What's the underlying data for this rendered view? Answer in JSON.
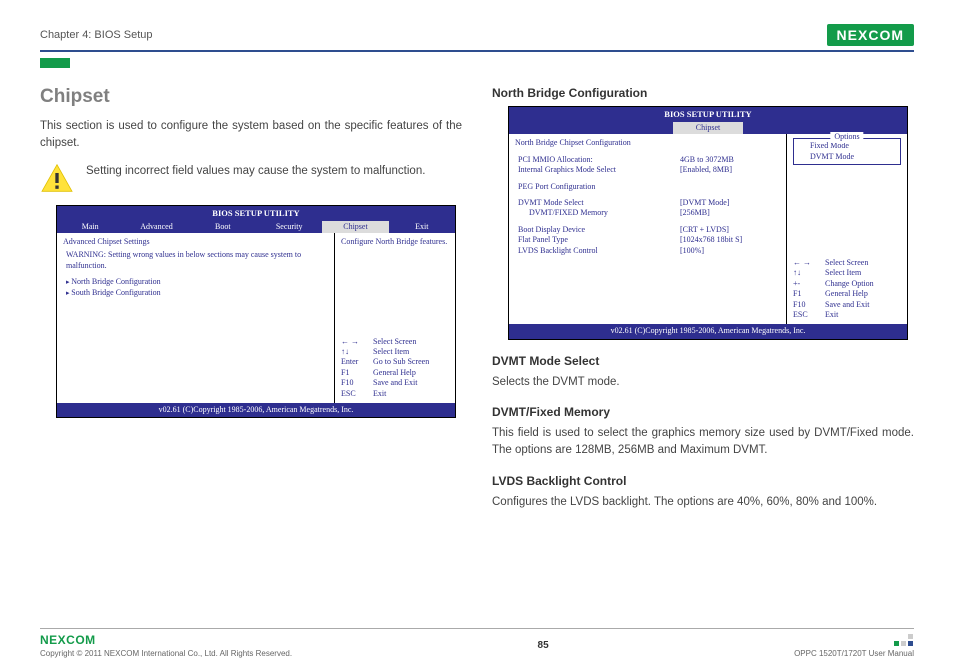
{
  "header": {
    "chapter": "Chapter 4: BIOS Setup",
    "brand": "NEXCOM"
  },
  "left": {
    "title": "Chipset",
    "intro": "This section is used to configure the system based on the specific features of the chipset.",
    "warning": "Setting incorrect field values may cause the system to malfunction.",
    "bios": {
      "title": "BIOS SETUP UTILITY",
      "tabs": {
        "main": "Main",
        "advanced": "Advanced",
        "boot": "Boot",
        "security": "Security",
        "chipset": "Chipset",
        "exit": "Exit"
      },
      "heading": "Advanced Chipset Settings",
      "warn": "WARNING: Setting wrong values in below sections may cause system to malfunction.",
      "items": {
        "nb": "North Bridge Configuration",
        "sb": "South Bridge Configuration"
      },
      "hint": "Configure North Bridge features.",
      "keys": {
        "k1": "← →",
        "v1": "Select Screen",
        "k2": "↑↓",
        "v2": "Select Item",
        "k3": "Enter",
        "v3": "Go to Sub Screen",
        "k4": "F1",
        "v4": "General Help",
        "k5": "F10",
        "v5": "Save and Exit",
        "k6": "ESC",
        "v6": "Exit"
      },
      "foot": "v02.61 (C)Copyright 1985-2006, American Megatrends, Inc."
    }
  },
  "right": {
    "title": "North Bridge Configuration",
    "bios": {
      "title": "BIOS SETUP UTILITY",
      "tab": "Chipset",
      "heading": "North Bridge Chipset Configuration",
      "rows": {
        "r1k": "PCI MMIO Allocation:",
        "r1v": "4GB to 3072MB",
        "r2k": "Internal Graphics Mode Select",
        "r2v": "[Enabled, 8MB]",
        "r3k": "PEG Port Configuration",
        "r4k": "DVMT Mode Select",
        "r4v": "[DVMT Mode]",
        "r5k": "DVMT/FIXED Memory",
        "r5v": "[256MB]",
        "r6k": "Boot Display Device",
        "r6v": "[CRT + LVDS]",
        "r7k": "Flat Panel Type",
        "r7v": "[1024x768 18bit S]",
        "r8k": "LVDS Backlight Control",
        "r8v": "[100%]"
      },
      "options_label": "Options",
      "options": {
        "o1": "Fixed Mode",
        "o2": "DVMT Mode"
      },
      "keys": {
        "k1": "← →",
        "v1": "Select Screen",
        "k2": "↑↓",
        "v2": "Select Item",
        "k3": "+-",
        "v3": "Change Option",
        "k4": "F1",
        "v4": "General Help",
        "k5": "F10",
        "v5": "Save and Exit",
        "k6": "ESC",
        "v6": "Exit"
      },
      "foot": "v02.61 (C)Copyright 1985-2006, American Megatrends, Inc."
    },
    "s1_title": "DVMT Mode Select",
    "s1_body": "Selects the DVMT mode.",
    "s2_title": "DVMT/Fixed Memory",
    "s2_body": "This field is used to select the graphics memory size used by DVMT/Fixed mode. The options are 128MB, 256MB and Maximum DVMT.",
    "s3_title": "LVDS Backlight Control",
    "s3_body": "Configures the LVDS backlight. The options are 40%, 60%, 80% and 100%."
  },
  "footer": {
    "brand": "NEXCOM",
    "copyright": "Copyright © 2011 NEXCOM International Co., Ltd. All Rights Reserved.",
    "page": "85",
    "manual": "OPPC 1520T/1720T User Manual"
  }
}
